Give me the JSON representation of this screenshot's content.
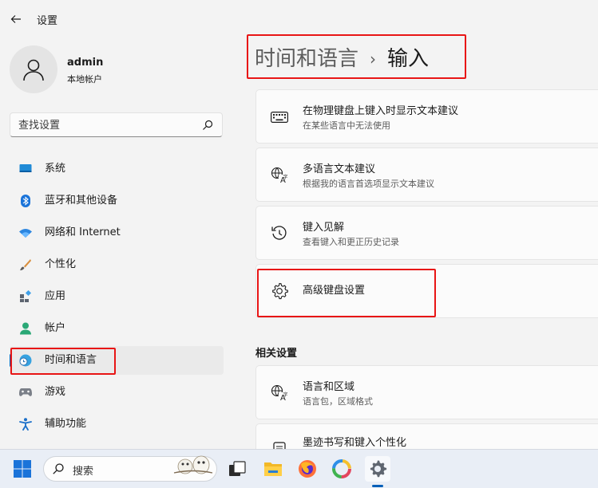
{
  "window": {
    "title": "设置"
  },
  "user": {
    "name": "admin",
    "account_type": "本地帐户"
  },
  "search": {
    "placeholder": "查找设置"
  },
  "sidebar": {
    "items": [
      {
        "label": "系统",
        "icon": "system-icon"
      },
      {
        "label": "蓝牙和其他设备",
        "icon": "bluetooth-icon"
      },
      {
        "label": "网络和 Internet",
        "icon": "wifi-icon"
      },
      {
        "label": "个性化",
        "icon": "brush-icon"
      },
      {
        "label": "应用",
        "icon": "apps-icon"
      },
      {
        "label": "帐户",
        "icon": "person-icon"
      },
      {
        "label": "时间和语言",
        "icon": "globe-clock-icon",
        "active": true
      },
      {
        "label": "游戏",
        "icon": "gamepad-icon"
      },
      {
        "label": "辅助功能",
        "icon": "accessibility-icon"
      }
    ]
  },
  "breadcrumb": {
    "parent": "时间和语言",
    "separator": "›",
    "current": "输入"
  },
  "cards": [
    {
      "title": "在物理键盘上键入时显示文本建议",
      "subtitle": "在某些语言中无法使用",
      "icon": "keyboard-icon"
    },
    {
      "title": "多语言文本建议",
      "subtitle": "根据我的语言首选项显示文本建议",
      "icon": "language-icon"
    },
    {
      "title": "键入见解",
      "subtitle": "查看键入和更正历史记录",
      "icon": "history-icon"
    },
    {
      "title": "高级键盘设置",
      "subtitle": "",
      "icon": "gear-icon"
    }
  ],
  "related": {
    "heading": "相关设置",
    "cards": [
      {
        "title": "语言和区域",
        "subtitle": "语言包，区域格式",
        "icon": "language-icon"
      },
      {
        "title": "墨迹书写和键入个性化",
        "subtitle": "",
        "icon": "pen-icon"
      }
    ]
  },
  "taskbar": {
    "search_label": "搜索",
    "apps": [
      "task-view-icon",
      "file-explorer-icon",
      "firefox-icon",
      "color-app-icon",
      "settings-icon"
    ]
  },
  "colors": {
    "accent": "#005fb8",
    "highlight": "#e81515"
  }
}
